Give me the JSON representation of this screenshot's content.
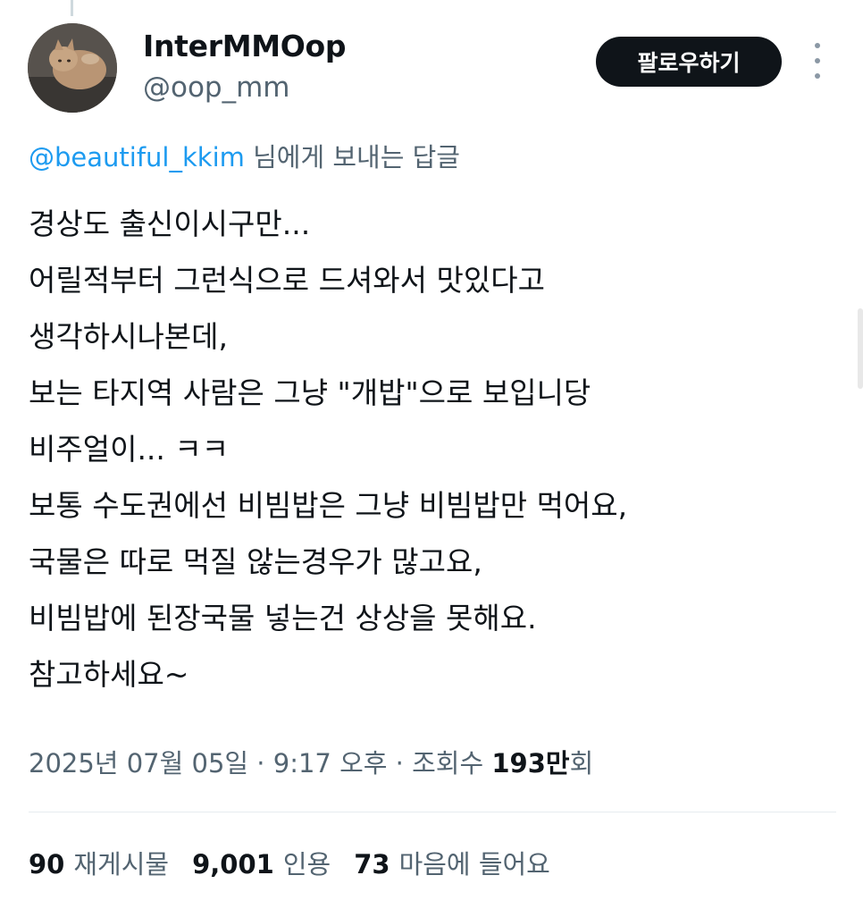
{
  "author": {
    "display_name": "InterMMOop",
    "handle": "@oop_mm"
  },
  "follow_button": {
    "label": "팔로우하기"
  },
  "reply_context": {
    "mention": "@beautiful_kkim",
    "suffix": " 님에게 보내는 답글"
  },
  "tweet": {
    "lines": [
      "경상도 출신이시구만...",
      "어릴적부터 그런식으로 드셔와서 맛있다고",
      "생각하시나본데,",
      "보는 타지역 사람은 그냥 \"개밥\"으로 보입니당",
      "비주얼이... ㅋㅋ",
      "보통 수도권에선 비빔밥은 그냥 비빔밥만 먹어요,",
      "국물은 따로 먹질 않는경우가 많고요,",
      "비빔밥에 된장국물 넣는건 상상을 못해요.",
      "참고하세요~"
    ]
  },
  "meta": {
    "timestamp_prefix": "2025년 07월 05일 · 9:17 오후 · 조회수 ",
    "views_number": "193만",
    "views_suffix": "회"
  },
  "stats": {
    "reposts": {
      "count": "90",
      "label": "재게시물"
    },
    "quotes": {
      "count": "9,001",
      "label": "인용"
    },
    "likes": {
      "count": "73",
      "label": "마음에 들어요"
    }
  },
  "icons": {
    "more": "more-vertical-icon"
  },
  "colors": {
    "mention_blue": "#1d9bf0",
    "secondary_text": "#536471",
    "follow_button_bg": "#0f1419"
  }
}
